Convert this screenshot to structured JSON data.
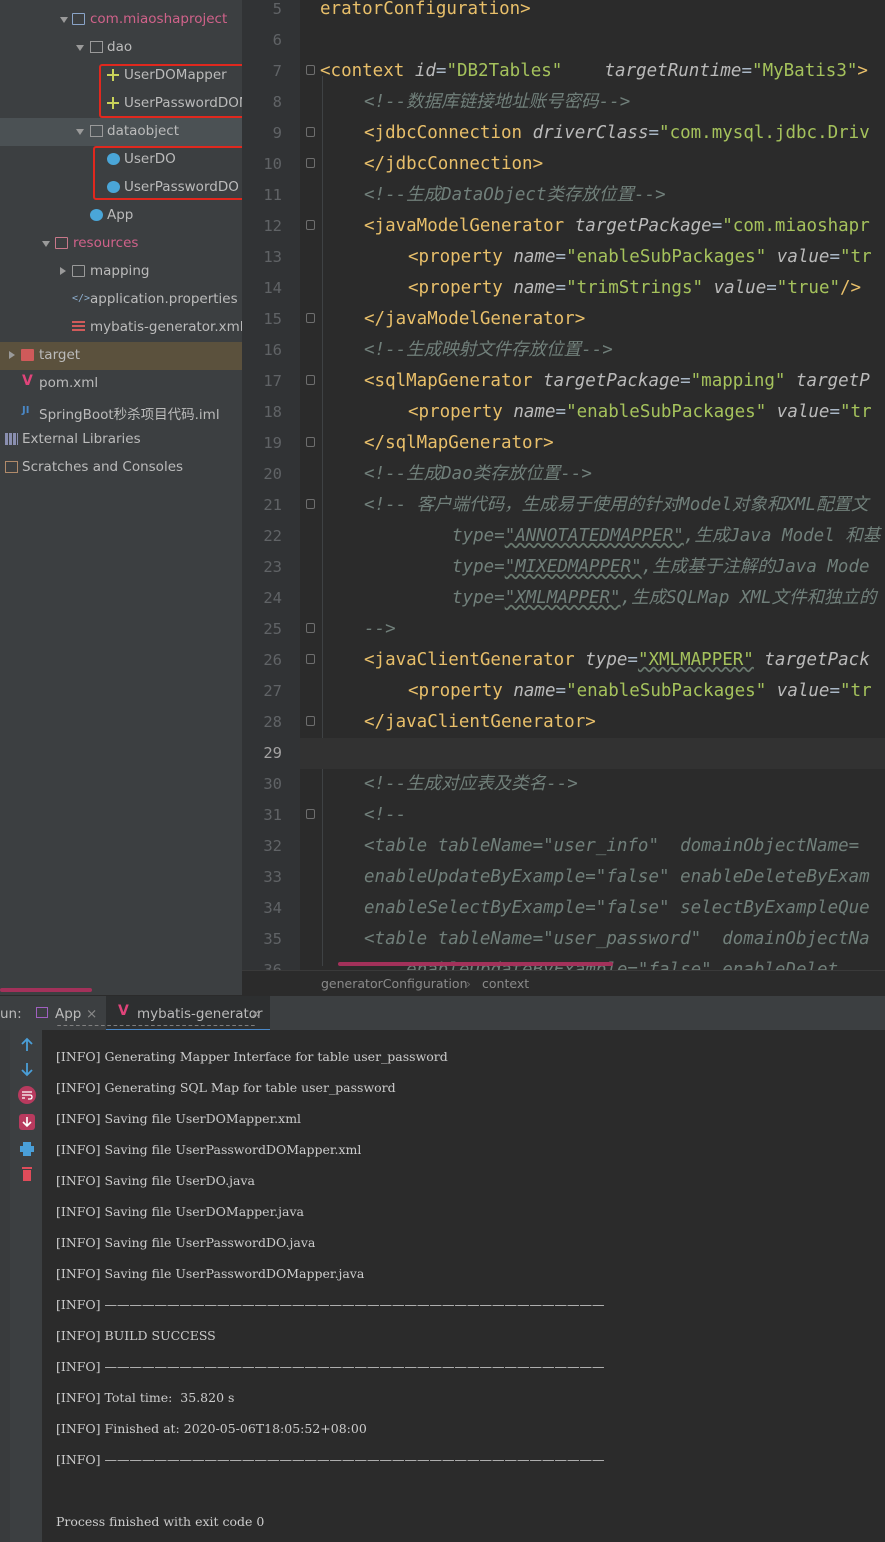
{
  "project_tree": {
    "items": [
      {
        "label": "com.miaoshaproject",
        "kind": "package",
        "color": "pink",
        "expanded": true
      },
      {
        "label": "dao",
        "kind": "package",
        "expanded": true
      },
      {
        "label": "UserDOMapper",
        "kind": "mapper"
      },
      {
        "label": "UserPasswordDOM",
        "kind": "mapper"
      },
      {
        "label": "dataobject",
        "kind": "package",
        "expanded": true
      },
      {
        "label": "UserDO",
        "kind": "class"
      },
      {
        "label": "UserPasswordDO",
        "kind": "class"
      },
      {
        "label": "App",
        "kind": "class"
      },
      {
        "label": "resources",
        "kind": "folder",
        "color": "pink",
        "expanded": true
      },
      {
        "label": "mapping",
        "kind": "folder",
        "expanded": false
      },
      {
        "label": "application.properties",
        "kind": "properties"
      },
      {
        "label": "mybatis-generator.xml",
        "kind": "xml"
      },
      {
        "label": "target",
        "kind": "folder",
        "color": "red",
        "expanded": false
      },
      {
        "label": "pom.xml",
        "kind": "maven"
      },
      {
        "label": "SpringBoot秒杀项目代码.iml",
        "kind": "iml"
      },
      {
        "label": "External Libraries",
        "kind": "libraries"
      },
      {
        "label": "Scratches and Consoles",
        "kind": "scratches"
      }
    ]
  },
  "editor": {
    "line_numbers": [
      "5",
      "6",
      "7",
      "8",
      "9",
      "10",
      "11",
      "12",
      "13",
      "14",
      "15",
      "16",
      "17",
      "18",
      "19",
      "20",
      "21",
      "22",
      "23",
      "24",
      "25",
      "26",
      "27",
      "28",
      "29",
      "30",
      "31",
      "32",
      "33",
      "34",
      "35",
      "36"
    ],
    "current_line": "29",
    "breadcrumb": [
      "generatorConfiguration",
      "context"
    ]
  },
  "code": {
    "l5": {
      "tag": "eratorConfiguration>"
    },
    "l7": {
      "open": "<context",
      "a1": " id",
      "e1": "=",
      "v1": "\"DB2Tables\"",
      "a2": "    targetRuntime",
      "e2": "=",
      "v2": "\"MyBatis3\"",
      "close": ">"
    },
    "l8": {
      "c": "<!--数据库链接地址账号密码-->"
    },
    "l9": {
      "open": "<jdbcConnection",
      "a1": " driverClass",
      "e1": "=",
      "v1": "\"com.mysql.jdbc.Driv"
    },
    "l10": {
      "tag": "</jdbcConnection>"
    },
    "l11": {
      "c": "<!--生成DataObject类存放位置-->"
    },
    "l12": {
      "open": "<javaModelGenerator",
      "a1": " targetPackage",
      "e1": "=",
      "v1": "\"com.miaoshapr"
    },
    "l13": {
      "open": "<property",
      "a1": " name",
      "e1": "=",
      "v1": "\"enableSubPackages\"",
      "a2": " value",
      "e2": "=",
      "v2": "\"tr"
    },
    "l14": {
      "open": "<property",
      "a1": " name",
      "e1": "=",
      "v1": "\"trimStrings\"",
      "a2": " value",
      "e2": "=",
      "v2": "\"true\"",
      "close": "/>"
    },
    "l15": {
      "tag": "</javaModelGenerator>"
    },
    "l16": {
      "c": "<!--生成映射文件存放位置-->"
    },
    "l17": {
      "open": "<sqlMapGenerator",
      "a1": " targetPackage",
      "e1": "=",
      "v1": "\"mapping\"",
      "a2": " targetP"
    },
    "l18": {
      "open": "<property",
      "a1": " name",
      "e1": "=",
      "v1": "\"enableSubPackages\"",
      "a2": " value",
      "e2": "=",
      "v2": "\"tr"
    },
    "l19": {
      "tag": "</sqlMapGenerator>"
    },
    "l20": {
      "c": "<!--生成Dao类存放位置-->"
    },
    "l21": {
      "c": "<!-- 客户端代码，生成易于使用的针对Model对象和XML配置文"
    },
    "l22": {
      "a": "type",
      "e": "=",
      "v": "\"ANNOTATEDMAPPER\"",
      "rest": ",生成Java Model 和基"
    },
    "l23": {
      "a": "type",
      "e": "=",
      "v": "\"MIXEDMAPPER\"",
      "rest": ",生成基于注解的Java Mode"
    },
    "l24": {
      "a": "type",
      "e": "=",
      "v": "\"XMLMAPPER\"",
      "rest": ",生成SQLMap XML文件和独立的"
    },
    "l25": {
      "c": "-->"
    },
    "l26": {
      "open": "<javaClientGenerator",
      "a1": " type",
      "e1": "=",
      "v1": "\"XMLMAPPER\"",
      "a2": " targetPack"
    },
    "l27": {
      "open": "<property",
      "a1": " name",
      "e1": "=",
      "v1": "\"enableSubPackages\"",
      "a2": " value",
      "e2": "=",
      "v2": "\"tr"
    },
    "l28": {
      "tag": "</javaClientGenerator>"
    },
    "l30": {
      "c": "<!--生成对应表及类名-->"
    },
    "l31": {
      "c": "<!--"
    },
    "l32": {
      "c": "<table tableName=\"user_info\"  domainObjectName="
    },
    "l33": {
      "c": "enableUpdateByExample=\"false\" enableDeleteByExam"
    },
    "l34": {
      "c": "enableSelectByExample=\"false\" selectByExampleQue"
    },
    "l35": {
      "c": "<table tableName=\"user_password\"  domainObjectNa"
    },
    "l36": {
      "c": "    enableUpdateByExample=\"false\" enableDelet"
    }
  },
  "run": {
    "prefix": "un:",
    "tabs": [
      {
        "label": "App"
      },
      {
        "label": "mybatis-generator"
      }
    ],
    "close_glyph": "×",
    "console": [
      "[INFO] Generating Mapper Interface for table user_password",
      "[INFO] Generating SQL Map for table user_password",
      "[INFO] Saving file UserDOMapper.xml",
      "[INFO] Saving file UserPasswordDOMapper.xml",
      "[INFO] Saving file UserDO.java",
      "[INFO] Saving file UserDOMapper.java",
      "[INFO] Saving file UserPasswordDO.java",
      "[INFO] Saving file UserPasswordDOMapper.java",
      "[INFO] ————————————————————————————————————————",
      "[INFO] BUILD SUCCESS",
      "[INFO] ————————————————————————————————————————",
      "[INFO] Total time:  35.820 s",
      "[INFO] Finished at: 2020-05-06T18:05:52+08:00",
      "[INFO] ————————————————————————————————————————"
    ],
    "exit_message": "Process finished with exit code 0"
  },
  "colors": {
    "tag": "#e8bf6a",
    "attr_value": "#a5c25c",
    "comment": "#707f7a",
    "highlight_box": "#e0281e",
    "accent": "#4a88c7"
  }
}
